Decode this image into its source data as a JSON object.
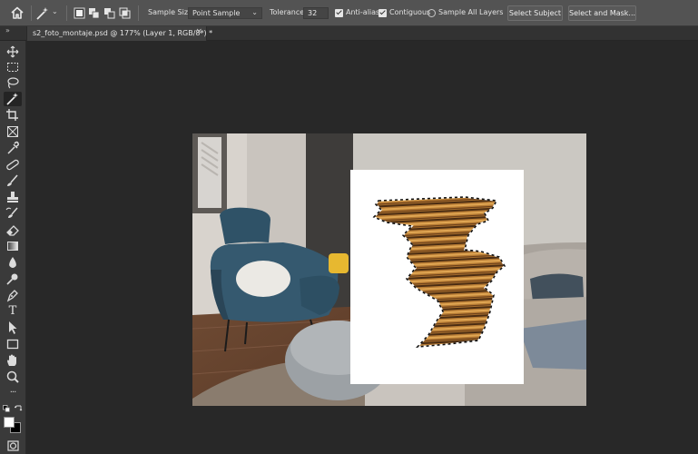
{
  "options_bar": {
    "icons": [
      "home-icon",
      "magic-wand-icon",
      "chevron-down-icon",
      "new-selection-icon",
      "add-selection-icon",
      "subtract-selection-icon",
      "intersect-selection-icon"
    ],
    "sample_size_label": "Sample Size:",
    "sample_size_value": "Point Sample",
    "tolerance_label": "Tolerance:",
    "tolerance_value": "32",
    "anti_alias_label": "Anti-alias",
    "anti_alias_checked": true,
    "contiguous_label": "Contiguous",
    "contiguous_checked": true,
    "sample_all_layers_label": "Sample All Layers",
    "sample_all_layers_checked": false,
    "select_subject_label": "Select Subject",
    "select_and_mask_label": "Select and Mask..."
  },
  "tab_bar": {
    "collapse_glyph": "»",
    "document_tab_title": "s2_foto_montaje.psd @ 177% (Layer 1, RGB/8*) *",
    "close_glyph": "×"
  },
  "toolbar": {
    "tools": [
      "move-tool",
      "marquee-tool",
      "lasso-tool",
      "magic-wand-tool",
      "crop-tool",
      "frame-tool",
      "eyedropper-tool",
      "healing-brush-tool",
      "brush-tool",
      "clone-stamp-tool",
      "history-brush-tool",
      "eraser-tool",
      "gradient-tool",
      "blur-tool",
      "dodge-tool",
      "pen-tool",
      "type-tool",
      "path-selection-tool",
      "rectangle-tool",
      "hand-tool",
      "zoom-tool",
      "more-tools",
      "swap-colors",
      "foreground-color",
      "quick-mask-mode"
    ],
    "active_tool": "magic-wand-tool",
    "type_tool_glyph": "T",
    "more_tools_glyph": "···"
  },
  "colors": {
    "options_bg": "#535353",
    "toolbar_bg": "#3a3a3a",
    "canvas_bg": "#282828",
    "foreground": "#ffffff",
    "background": "#000000"
  }
}
